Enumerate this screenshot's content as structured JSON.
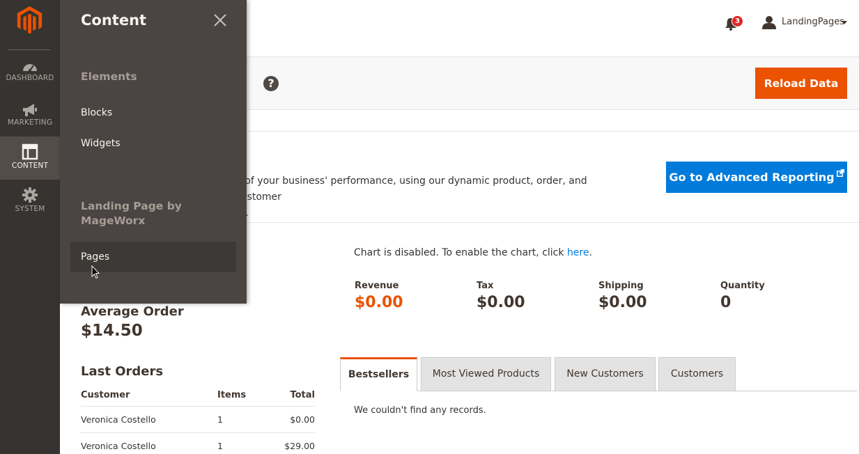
{
  "nav": {
    "items": [
      {
        "label": "DASHBOARD",
        "icon": "dashboard-icon"
      },
      {
        "label": "MARKETING",
        "icon": "megaphone-icon"
      },
      {
        "label": "CONTENT",
        "icon": "layout-icon"
      },
      {
        "label": "SYSTEM",
        "icon": "gear-icon"
      }
    ],
    "active": "CONTENT"
  },
  "header": {
    "notifications_count": "3",
    "user_name": "LandingPages"
  },
  "action_bar": {
    "reload_label": "Reload Data",
    "help_label": "?"
  },
  "advanced_reporting": {
    "text": "d of your business' performance, using our dynamic product, order, and customer ta.",
    "text_line1": "d of your business' performance, using our dynamic product, order, and customer",
    "text_line2": "ta.",
    "button_label": "Go to Advanced Reporting"
  },
  "dashboard": {
    "chart_message_prefix": "Chart is disabled. To enable the chart, click ",
    "chart_message_link": "here",
    "chart_message_suffix": ".",
    "stats": [
      {
        "label": "Revenue",
        "value": "$0.00"
      },
      {
        "label": "Tax",
        "value": "$0.00"
      },
      {
        "label": "Shipping",
        "value": "$0.00"
      },
      {
        "label": "Quantity",
        "value": "0"
      }
    ],
    "average_order_label": "Average Order",
    "average_order_value": "$14.50",
    "last_orders_title": "Last Orders",
    "last_orders_columns": [
      "Customer",
      "Items",
      "Total"
    ],
    "last_orders_rows": [
      [
        "Veronica Costello",
        "1",
        "$0.00"
      ],
      [
        "Veronica Costello",
        "1",
        "$29.00"
      ]
    ],
    "tabs": [
      "Bestsellers",
      "Most Viewed Products",
      "New Customers",
      "Customers"
    ],
    "active_tab": "Bestsellers",
    "no_records": "We couldn't find any records."
  },
  "flyout": {
    "title": "Content",
    "sections": [
      {
        "title": "Elements",
        "items": [
          "Blocks",
          "Widgets"
        ]
      },
      {
        "title_line1": "Landing Page by",
        "title_line2": "MageWorx",
        "items": [
          "Pages"
        ]
      }
    ]
  },
  "colors": {
    "accent_orange": "#eb5202",
    "link_blue": "#007bdb",
    "nav_bg": "#373330",
    "flyout_bg": "#4a4542"
  }
}
